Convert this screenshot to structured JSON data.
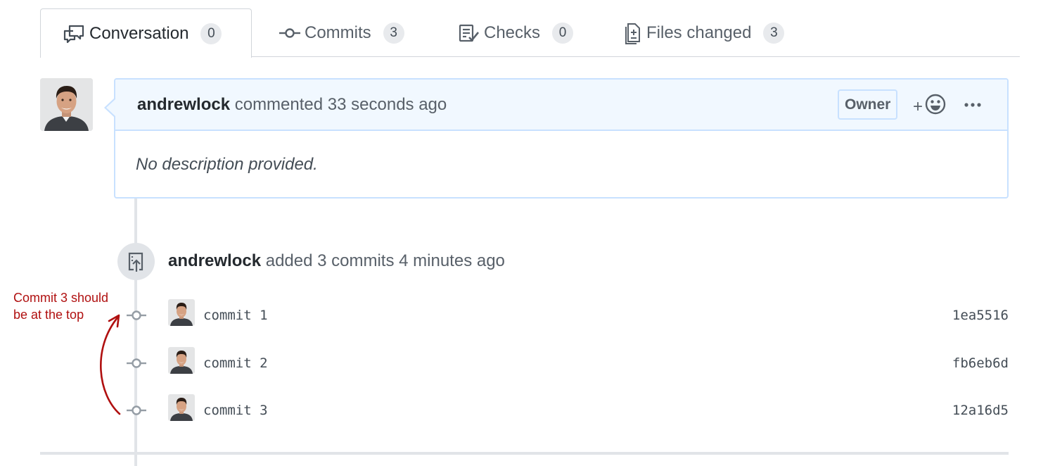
{
  "tabs": [
    {
      "label": "Conversation",
      "count": "0",
      "icon": "conversation-icon",
      "selected": true
    },
    {
      "label": "Commits",
      "count": "3",
      "icon": "commit-icon",
      "selected": false
    },
    {
      "label": "Checks",
      "count": "0",
      "icon": "checklist-icon",
      "selected": false
    },
    {
      "label": "Files changed",
      "count": "3",
      "icon": "diff-icon",
      "selected": false
    }
  ],
  "comment": {
    "author": "andrewlock",
    "action": "commented",
    "time": "33 seconds ago",
    "badge": "Owner",
    "reaction_label": "+",
    "body": "No description provided."
  },
  "push_event": {
    "author": "andrewlock",
    "text": "added 3 commits 4 minutes ago"
  },
  "commits": [
    {
      "message": "commit 1",
      "sha": "1ea5516"
    },
    {
      "message": "commit 2",
      "sha": "fb6eb6d"
    },
    {
      "message": "commit 3",
      "sha": "12a16d5"
    }
  ],
  "annotation": {
    "line1": "Commit 3 should",
    "line2": "be at the top"
  },
  "colors": {
    "header_bg": "#f1f8ff",
    "border_blue": "#c8e1ff",
    "annotation_red": "#b01010",
    "muted_text": "#586069"
  }
}
